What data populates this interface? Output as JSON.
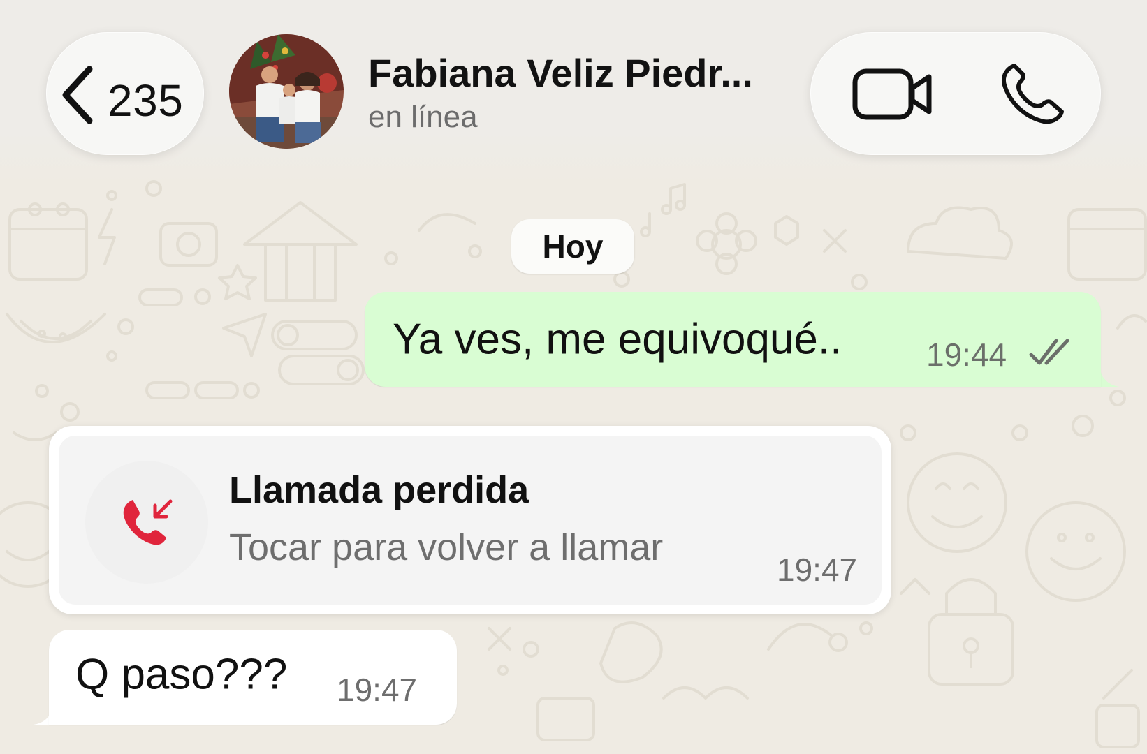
{
  "header": {
    "back_count": "235",
    "contact_name": "Fabiana Veliz Piedr...",
    "status": "en línea"
  },
  "chat": {
    "date_separator": "Hoy",
    "messages": [
      {
        "direction": "outgoing",
        "text": "Ya ves, me equivoqué..",
        "time": "19:44",
        "read_state": "read"
      },
      {
        "direction": "incoming",
        "type": "missed_call",
        "title": "Llamada perdida",
        "subtitle": "Tocar para volver a llamar",
        "time": "19:47"
      },
      {
        "direction": "incoming",
        "text": "Q paso???",
        "time": "19:47"
      }
    ]
  },
  "colors": {
    "background": "#efebe3",
    "outgoing_bubble": "#d9fdd3",
    "incoming_bubble": "#ffffff",
    "missed_call_red": "#e0253c"
  },
  "icons": [
    "back-chevron-icon",
    "video-call-icon",
    "phone-icon",
    "missed-call-icon",
    "double-check-icon"
  ]
}
